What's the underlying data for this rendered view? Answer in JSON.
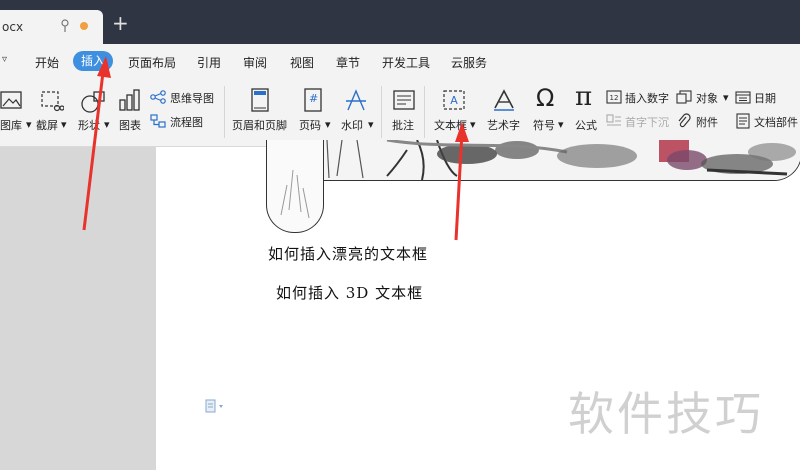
{
  "window": {
    "doc_tab_name": "ocx",
    "new_tab_symbol": "+"
  },
  "menu": {
    "dropdown_symbol": "▿",
    "items": [
      "开始",
      "插入",
      "页面布局",
      "引用",
      "审阅",
      "视图",
      "章节",
      "开发工具",
      "云服务"
    ],
    "active": "插入"
  },
  "ribbon": {
    "picture_library": "图库",
    "screenshot": "截屏",
    "shapes": "形状",
    "chart": "图表",
    "mind_map": "思维导图",
    "flowchart": "流程图",
    "header_footer": "页眉和页脚",
    "page_number": "页码",
    "watermark": "水印",
    "comment": "批注",
    "text_box": "文本框",
    "word_art": "艺术字",
    "symbol": "符号",
    "formula": "公式",
    "insert_number": "插入数字",
    "drop_cap": "首字下沉",
    "object": "对象",
    "attachment": "附件",
    "date": "日期",
    "doc_parts": "文档部件",
    "page_number_glyph": "#",
    "omega_glyph": "Ω",
    "pi_glyph": "π",
    "caret": "▾"
  },
  "document": {
    "line1": "如何插入漂亮的文本框",
    "line2": "如何插入 3D 文本框"
  },
  "watermark_text": "软件技巧",
  "colors": {
    "accent": "#3f8fe0",
    "arrow": "#e8322b",
    "titlebar": "#2f3542"
  }
}
